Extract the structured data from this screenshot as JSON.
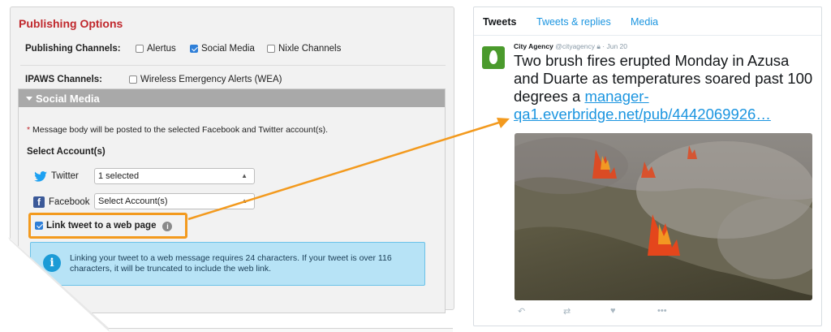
{
  "publishing": {
    "title": "Publishing Options",
    "channels_label": "Publishing Channels:",
    "channels": [
      {
        "label": "Alertus",
        "checked": false
      },
      {
        "label": "Social Media",
        "checked": true
      },
      {
        "label": "Nixle Channels",
        "checked": false
      }
    ],
    "ipaws_label": "IPAWS Channels:",
    "ipaws_option": {
      "label": "Wireless Emergency Alerts (WEA)",
      "checked": false
    }
  },
  "social_media": {
    "header": "Social Media",
    "note_asterisk": "*",
    "note": "Message body will be posted to the selected Facebook and Twitter account(s).",
    "select_accounts_label": "Select Account(s)",
    "twitter": {
      "label": "Twitter",
      "value": "1 selected"
    },
    "facebook": {
      "label": "Facebook",
      "value": "Select Account(s)"
    },
    "link_tweet": {
      "label": "Link tweet to a web page",
      "checked": true
    },
    "info_text": "Linking your tweet to a web message requires 24 characters. If your tweet is over 116 characters, it will be truncated to include the web link."
  },
  "tweet": {
    "tabs": [
      "Tweets",
      "Tweets & replies",
      "Media"
    ],
    "active_tab": "Tweets",
    "author_name": "City Agency",
    "author_handle": "@cityagency",
    "date": "Jun 20",
    "text": "Two brush fires erupted Monday in Azusa and Duarte as temperatures soared past 100 degrees a ",
    "link_text": "manager-qa1.everbridge.net/pub/4442069926…",
    "actions": [
      "reply-icon",
      "retweet-icon",
      "like-icon",
      "more-icon"
    ]
  },
  "colors": {
    "accent_red": "#c0282d",
    "highlight_orange": "#f39a1e",
    "twitter_blue": "#1b95e0",
    "info_bg": "#b7e3f6"
  }
}
